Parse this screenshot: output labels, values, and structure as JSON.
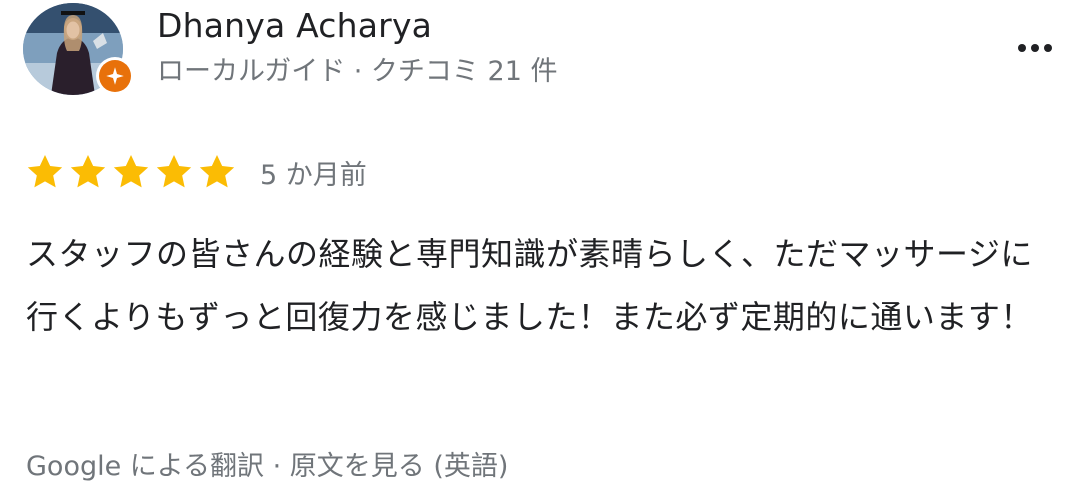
{
  "reviewer": {
    "name": "Dhanya Acharya",
    "meta": "ローカルガイド · クチコミ 21 件"
  },
  "rating": {
    "stars": 5,
    "max": 5,
    "date": "5 か月前",
    "star_color": "#fbbc04"
  },
  "review": {
    "text": "スタッフの皆さんの経験と専門知識が素晴らしく、ただマッサージに行くよりもずっと回復力を感じました！また必ず定期的に通います！"
  },
  "translation": {
    "by_google": "Google による翻訳",
    "separator": " · ",
    "view_original": "原文を見る (英語)"
  },
  "icons": {
    "more": "more-vert-icon",
    "badge": "local-guide-star-icon"
  },
  "colors": {
    "badge": "#e8710a",
    "secondary_text": "#70757a"
  }
}
